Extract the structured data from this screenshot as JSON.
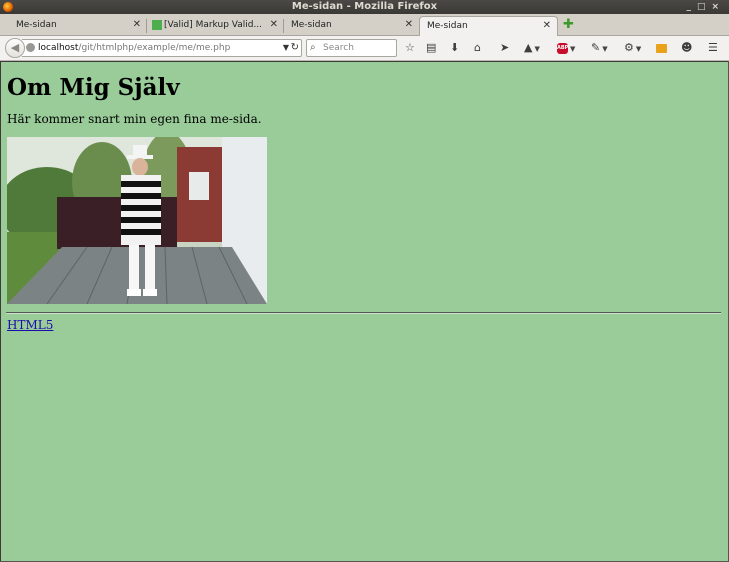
{
  "window": {
    "title": "Me-sidan - Mozilla Firefox",
    "controls": [
      "_",
      "□",
      "×"
    ]
  },
  "tabs": [
    {
      "label": "Me-sidan",
      "active": false
    },
    {
      "label": "[Valid] Markup Valid...",
      "active": false
    },
    {
      "label": "Me-sidan",
      "active": false
    },
    {
      "label": "Me-sidan",
      "active": true
    }
  ],
  "toolbar": {
    "url_host": "localhost",
    "url_path": "/git/htmlphp/example/me/me.php",
    "search_placeholder": "Search",
    "abp_label": "ABP"
  },
  "page": {
    "heading": "Om Mig Själv",
    "intro": "Här kommer snart min egen fina me-sida.",
    "link_label": "HTML5",
    "background_color": "#99cc99"
  }
}
